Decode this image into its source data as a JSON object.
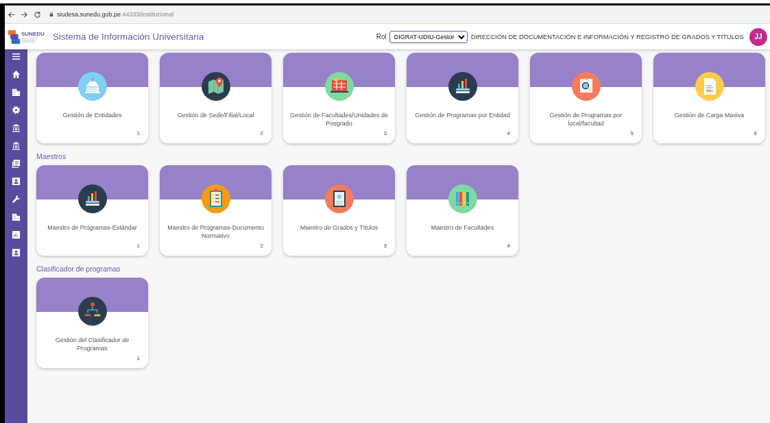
{
  "browser": {
    "url_host": "siudesa.sunedu.gob.pe",
    "url_path": ":44333/institucional"
  },
  "header": {
    "logo_text": "SUNEDU",
    "title": "Sistema de Información Universitaria",
    "role_label": "Rol",
    "role_value": "DIGRAT-UDIU-Gestor",
    "department": "DIRECCIÓN DE DOCUMENTACIÓN E INFORMACIÓN Y REGISTRO DE GRADOS Y TÍTULOS",
    "avatar": "JJ"
  },
  "sidebar": {
    "items": [
      {
        "kind": "menu"
      },
      {
        "kind": "home"
      },
      {
        "kind": "building"
      },
      {
        "kind": "gear"
      },
      {
        "kind": "bank"
      },
      {
        "kind": "bank"
      },
      {
        "kind": "news"
      },
      {
        "kind": "contact"
      },
      {
        "kind": "wrench"
      },
      {
        "kind": "building"
      },
      {
        "kind": "chart"
      },
      {
        "kind": "contact"
      }
    ]
  },
  "sections": [
    {
      "cards": [
        {
          "title": "Gestión de Entidades",
          "number": "1",
          "kind": "building"
        },
        {
          "title": "Gestión de Sede/Filial/Local",
          "number": "2",
          "kind": "map"
        },
        {
          "title": "Gestión de Facultades/Unidades de Posgrado",
          "number": "3",
          "kind": "grid"
        },
        {
          "title": "Gestión de Programas por Entidad",
          "number": "4",
          "kind": "chart"
        },
        {
          "title": "Gestión de Programas por local/facultad",
          "number": "5",
          "kind": "search"
        },
        {
          "title": "Gestión de Carga Masiva",
          "number": "6",
          "kind": "document"
        }
      ]
    },
    {
      "title": "Maestros",
      "cards": [
        {
          "title": "Maestro de Programas-Estándar",
          "number": "1",
          "kind": "chart"
        },
        {
          "title": "Maestro de Programas-Documento Normativo",
          "number": "2",
          "kind": "checklist"
        },
        {
          "title": "Maestro de Grados y Títulos",
          "number": "3",
          "kind": "certificate"
        },
        {
          "title": "Maestro de Facultades",
          "number": "4",
          "kind": "binders"
        }
      ]
    },
    {
      "title": "Clasificador de programas",
      "cards": [
        {
          "title": "Gestión del Clasificador de Programas",
          "number": "1",
          "kind": "hierarchy"
        }
      ]
    }
  ]
}
